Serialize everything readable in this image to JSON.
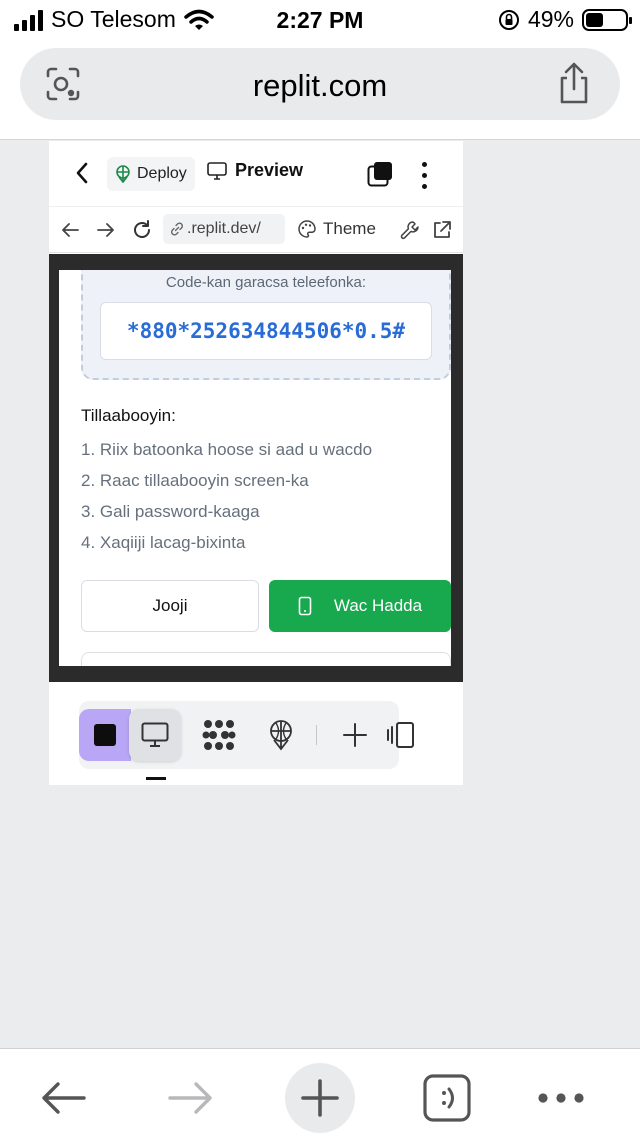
{
  "status_bar": {
    "carrier": "SO Telesom",
    "time": "2:27 PM",
    "battery": "49%"
  },
  "browser": {
    "url": "replit.com"
  },
  "replit_header": {
    "deploy_label": "Deploy",
    "preview_label": "Preview"
  },
  "preview_nav": {
    "address": ".replit.dev/",
    "theme_label": "Theme"
  },
  "app": {
    "code_label": "Code-kan garacsa teleefonka:",
    "code_value": "*880*252634844506*0.5#",
    "steps_title": "Tillaabooyin:",
    "steps": [
      "1. Riix batoonka hoose si aad u wacdo",
      "2. Raac tillaabooyin screen-ka",
      "3. Gali password-kaaga",
      "4. Xaqiiji lacag-bixinta"
    ],
    "cancel_button": "Jooji",
    "call_button": "Wac Hadda"
  },
  "toolbar": {
    "icons": [
      "stop-icon",
      "monitor-icon",
      "workflow-icon",
      "deploy-icon",
      "plus-icon",
      "panel-toggle-icon"
    ],
    "accent": "#b9a6f5"
  },
  "colors": {
    "call_button": "#18a84e",
    "code_text": "#2a6cd6"
  }
}
